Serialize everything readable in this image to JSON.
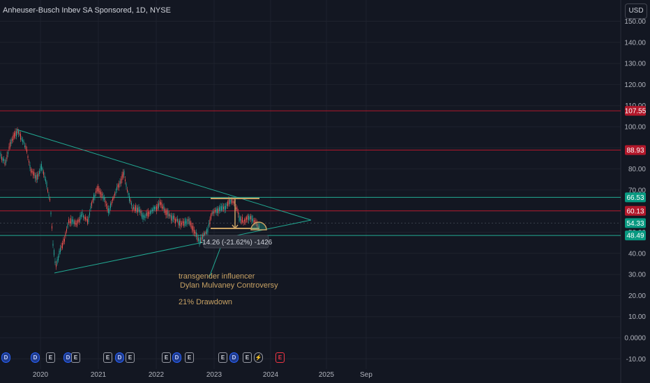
{
  "header": {
    "title": "Anheuser-Busch Inbev SA Sponsored, 1D, NYSE",
    "currency": "USD"
  },
  "price_axis": {
    "ticks": [
      "150.00",
      "140.00",
      "130.00",
      "120.00",
      "110.00",
      "100.00",
      "90.00",
      "80.00",
      "70.00",
      "60.00",
      "50.00",
      "40.00",
      "30.00",
      "20.00",
      "10.00",
      "0.0000",
      "-10.00"
    ],
    "values": [
      150,
      140,
      130,
      120,
      110,
      100,
      90,
      80,
      70,
      60,
      50,
      40,
      30,
      20,
      10,
      0,
      -10
    ]
  },
  "time_axis": {
    "labels": [
      "2020",
      "2021",
      "2022",
      "2023",
      "2024",
      "2025",
      "Sep"
    ]
  },
  "price_labels": [
    {
      "text": "107.55",
      "value": 107.55,
      "color": "#b2182b"
    },
    {
      "text": "88.93",
      "value": 88.93,
      "color": "#b2182b"
    },
    {
      "text": "66.53",
      "value": 66.53,
      "color": "#089981"
    },
    {
      "text": "60.13",
      "value": 60.13,
      "color": "#b2182b"
    },
    {
      "text": "54.33",
      "value": 54.33,
      "color": "#089981"
    },
    {
      "text": "48.49",
      "value": 48.49,
      "color": "#089981"
    }
  ],
  "annotations": {
    "measure_label": "-14.26 (-21.62%) -1426",
    "note_line1": "transgender influencer",
    "note_line2": "Dylan Mulvaney Controversy",
    "note_line3": "21% Drawdown"
  },
  "events": [
    {
      "type": "D",
      "label": "D"
    },
    {
      "type": "D",
      "label": "D"
    },
    {
      "type": "E",
      "label": "E"
    },
    {
      "type": "D",
      "label": "D"
    },
    {
      "type": "E",
      "label": "E"
    },
    {
      "type": "E",
      "label": "E"
    },
    {
      "type": "D",
      "label": "D"
    },
    {
      "type": "E",
      "label": "E"
    },
    {
      "type": "E",
      "label": "E"
    },
    {
      "type": "D",
      "label": "D"
    },
    {
      "type": "E",
      "label": "E"
    },
    {
      "type": "E",
      "label": "E"
    },
    {
      "type": "D",
      "label": "D"
    },
    {
      "type": "E",
      "label": "E"
    },
    {
      "type": "S",
      "label": "⚡"
    },
    {
      "type": "R",
      "label": "E"
    }
  ],
  "colors": {
    "background": "#131722",
    "grid": "#1e222d",
    "candle_up": "#26a69a",
    "candle_down": "#ef5350",
    "trendline": "#22ab94",
    "red_level": "#b2182b",
    "teal_level": "#22ab94",
    "annotation": "#c8a264"
  }
}
